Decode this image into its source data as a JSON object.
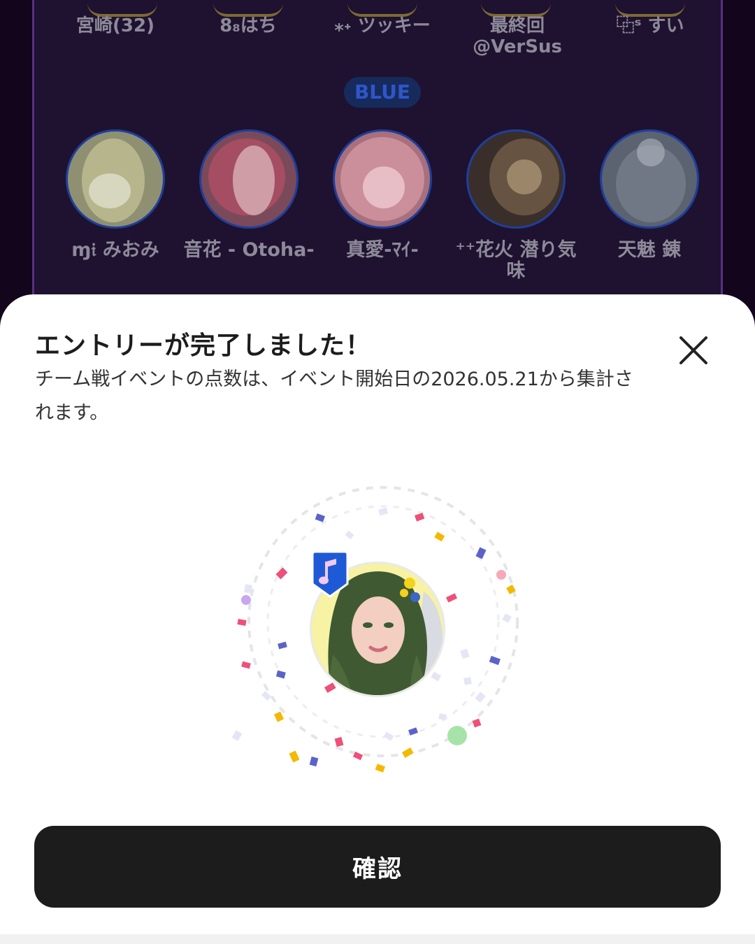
{
  "team_top": {
    "names": [
      "宮崎(32)",
      "8₈はち",
      "⁎˖ ツッキー",
      "最終回 @VerSus",
      "⿻ˢ すい"
    ]
  },
  "team_blue": {
    "label": "BLUE",
    "members": [
      "ɱ𝔦 みおみ",
      "音花 - Otoha-",
      "真愛-ﾏｲ-",
      "⁺⁺花火 潜り気味",
      "天魅 錬"
    ]
  },
  "modal": {
    "title": "エントリーが完了しました！",
    "description": "チーム戦イベントの点数は、イベント開始日の2026.05.21から集計されます。",
    "close_icon": "close-icon",
    "badge_icon": "music-note-badge-icon",
    "confirm_label": "確認"
  },
  "colors": {
    "accent_blue": "#1f5ad6",
    "button": "#1c1c1c",
    "panel_border": "#5a2f86"
  }
}
